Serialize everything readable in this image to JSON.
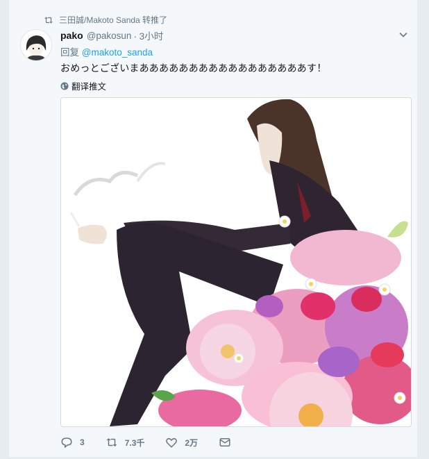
{
  "retweet": {
    "text": "三田誠/Makoto Sanda 转推了",
    "icon": "retweet-icon"
  },
  "tweet": {
    "fullname": "pako",
    "username": "@pakosun",
    "time": "· 3小时",
    "reply_prefix": "回复",
    "reply_to": "@makoto_sanda",
    "text": "おめっとございまあああああああああああああああああす！",
    "translate": "翻译推文"
  },
  "actions": {
    "reply_count": "3",
    "retweet_count": "7.3千",
    "like_count": "2万"
  },
  "colors": {
    "accent": "#1da1f2",
    "muted": "#657786",
    "text": "#14171a"
  }
}
